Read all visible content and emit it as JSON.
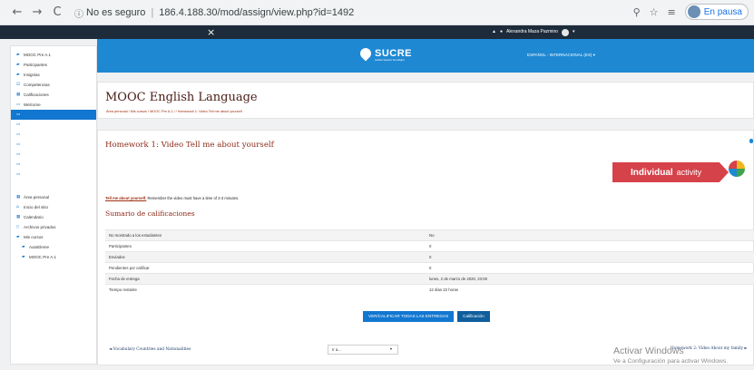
{
  "browser": {
    "back": "←",
    "forward": "→",
    "reload": "C",
    "security": "No es seguro",
    "url": "186.4.188.30/mod/assign/view.php?id=1492",
    "pause_label": "En pausa"
  },
  "topbar": {
    "close": "×",
    "user_name": "Alexandra Maza Pazmino"
  },
  "sidebar": {
    "items": [
      {
        "label": "MOOC Pre A.1",
        "icon": "graduation-cap-icon"
      },
      {
        "label": "Participantes",
        "icon": "users-icon"
      },
      {
        "label": "Insignias",
        "icon": "badge-icon"
      },
      {
        "label": "Competencias",
        "icon": "check-icon"
      },
      {
        "label": "Calificaciones",
        "icon": "table-icon"
      },
      {
        "label": "Welcome",
        "icon": "folder-icon"
      },
      {
        "label": "",
        "icon": "folder-icon"
      },
      {
        "label": "",
        "icon": "folder-icon"
      },
      {
        "label": "",
        "icon": "folder-icon"
      },
      {
        "label": "",
        "icon": "folder-icon"
      },
      {
        "label": "",
        "icon": "folder-icon"
      },
      {
        "label": "",
        "icon": "folder-icon"
      },
      {
        "label": "",
        "icon": "folder-icon"
      }
    ],
    "lower_items": [
      {
        "label": "Área personal",
        "icon": "dashboard-icon"
      },
      {
        "label": "Inicio del sitio",
        "icon": "home-icon"
      },
      {
        "label": "Calendario",
        "icon": "calendar-icon"
      },
      {
        "label": "Archivos privados",
        "icon": "file-icon"
      },
      {
        "label": "Mis cursos",
        "icon": "graduation-cap-icon"
      },
      {
        "label": "AutoEleme",
        "icon": "graduation-cap-icon"
      },
      {
        "label": "MOOC Pre A.1",
        "icon": "graduation-cap-icon"
      }
    ]
  },
  "header": {
    "logo": "SUCRE",
    "logo_tagline": "Instituto Superior Tecnológico",
    "language": "ESPAÑOL - INTERNACIONAL (ES) ▾"
  },
  "course": {
    "title": "MOOC English Language",
    "breadcrumb": "Área personal  /  Mis cursos  /  MOOC Pre A.1  /    /  Homework 1: Video Tell me about yourself"
  },
  "assignment": {
    "title": "Homework 1: Video Tell me about yourself",
    "badge_strong": "Individual",
    "badge_rest": "activity",
    "instruction_link": "Tell me about yourself.",
    "instruction_text": " Remember the video must have a time of 2-3 minutes.",
    "summary_title": "Sumario de calificaciones",
    "rows": [
      {
        "label": "No mostrado a los estudiantes",
        "value": "No"
      },
      {
        "label": "Participantes",
        "value": "0"
      },
      {
        "label": "Enviados",
        "value": "0"
      },
      {
        "label": "Pendientes por calificar",
        "value": "0"
      },
      {
        "label": "Fecha de entrega",
        "value": "lunes, 2 de marzo de 2020, 23:00"
      },
      {
        "label": "Tiempo restante",
        "value": "12 días 22 horas"
      }
    ],
    "btn_view": "VER/CALIFICAR TODAS LAS ENTREGAS",
    "btn_grade": "Calificación",
    "prev_link": "◄ Vocabulary Countries and Nationalities",
    "jump_label": "Ir a...",
    "next_link": "Homework 2: Video About my family ►"
  },
  "watermark": {
    "line1": "Activar Windows",
    "line2": "Ve a Configuración para activar Windows."
  }
}
